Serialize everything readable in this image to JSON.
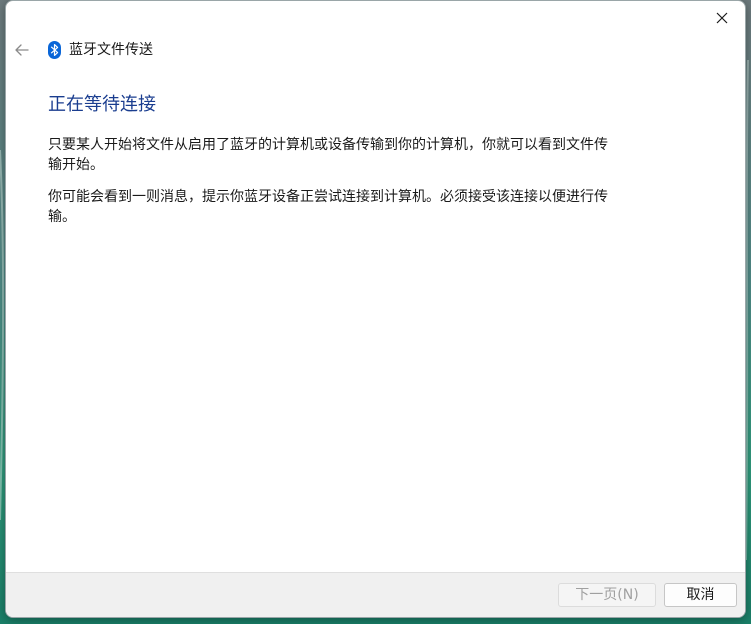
{
  "window": {
    "title": "蓝牙文件传送",
    "close_icon": "close-icon",
    "back_icon": "back-arrow-icon",
    "app_icon": "bluetooth-icon"
  },
  "content": {
    "heading": "正在等待连接",
    "paragraph1": "只要某人开始将文件从启用了蓝牙的计算机或设备传输到你的计算机，你就可以看到文件传输开始。",
    "paragraph2": "你可能会看到一则消息，提示你蓝牙设备正尝试连接到计算机。必须接受该连接以便进行传输。"
  },
  "footer": {
    "next_label": "下一页(N)",
    "next_enabled": false,
    "cancel_label": "取消"
  },
  "colors": {
    "heading": "#1a3d8f",
    "bluetooth_badge": "#0a66d8"
  }
}
